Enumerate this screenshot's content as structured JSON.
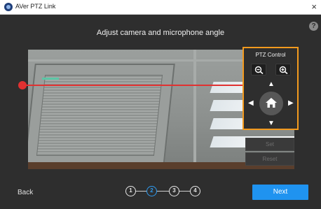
{
  "window": {
    "title": "AVer PTZ Link",
    "close_glyph": "×"
  },
  "help": {
    "label": "?"
  },
  "heading": "Adjust camera and microphone angle",
  "preview": {
    "description_icon": "camera-feed"
  },
  "ptz": {
    "title": "PTZ Control",
    "zoom_out_icon": "zoom-out-icon",
    "zoom_in_icon": "zoom-in-icon",
    "arrows": {
      "up": "▲",
      "down": "▼",
      "left": "◀",
      "right": "▶"
    },
    "home_icon": "home-icon",
    "accent_color": "#f39a1e"
  },
  "buttons": {
    "set": "Set",
    "reset": "Reset",
    "back": "Back",
    "next": "Next"
  },
  "steps": {
    "items": [
      "1",
      "2",
      "3",
      "4"
    ],
    "active": "2"
  },
  "colors": {
    "background": "#2e2e2e",
    "primary": "#1f93f0",
    "level_line": "#e03131"
  }
}
